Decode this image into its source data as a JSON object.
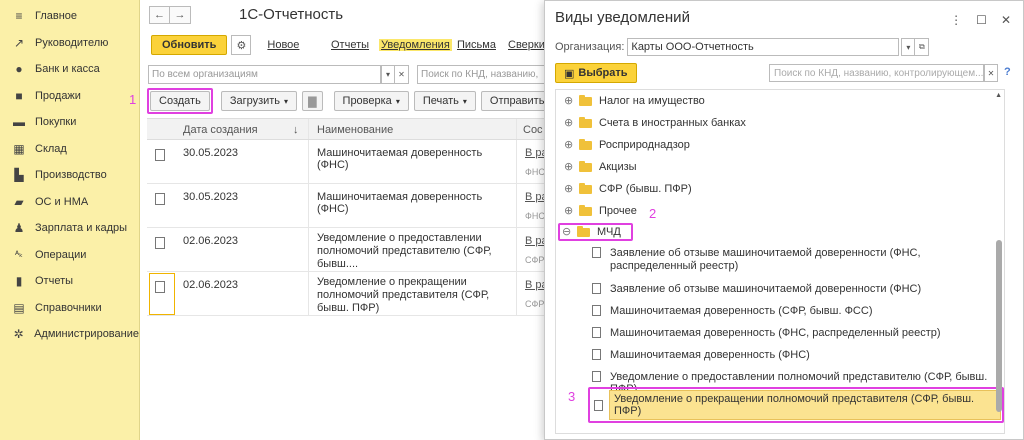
{
  "sidebar": {
    "items": [
      {
        "label": "Главное",
        "icon": "menu-icon",
        "glyph": "≡"
      },
      {
        "label": "Руководителю",
        "icon": "chart-trend-icon",
        "glyph": "↗"
      },
      {
        "label": "Банк и касса",
        "icon": "coins-icon",
        "glyph": "●"
      },
      {
        "label": "Продажи",
        "icon": "bag-icon",
        "glyph": "■"
      },
      {
        "label": "Покупки",
        "icon": "cart-icon",
        "glyph": "▬"
      },
      {
        "label": "Склад",
        "icon": "warehouse-icon",
        "glyph": "▦"
      },
      {
        "label": "Производство",
        "icon": "factory-icon",
        "glyph": "▙"
      },
      {
        "label": "ОС и НМА",
        "icon": "truck-icon",
        "glyph": "▰"
      },
      {
        "label": "Зарплата и кадры",
        "icon": "people-icon",
        "glyph": "♟"
      },
      {
        "label": "Операции",
        "icon": "operations-icon",
        "glyph": "ᴬₖ"
      },
      {
        "label": "Отчеты",
        "icon": "bar-chart-icon",
        "glyph": "▮"
      },
      {
        "label": "Справочники",
        "icon": "book-icon",
        "glyph": "▤"
      },
      {
        "label": "Администрирование",
        "icon": "gear-icon",
        "glyph": "✲"
      }
    ]
  },
  "main": {
    "title": "1С-Отчетность",
    "back": "←",
    "forward": "→",
    "refresh_label": "Обновить",
    "new_label": "Новое",
    "tabs": [
      "Отчеты",
      "Уведомления",
      "Письма",
      "Сверки"
    ],
    "org_placeholder": "По всем организациям",
    "search_placeholder": "Поиск по КНД, названию,",
    "toolbar": {
      "create": "Создать",
      "load": "Загрузить",
      "check": "Проверка",
      "print": "Печать",
      "send": "Отправить"
    },
    "table": {
      "columns": [
        "Дата создания",
        "Наименование",
        "Сос"
      ],
      "rows": [
        {
          "date": "30.05.2023",
          "name": "Машиночитаемая доверенность (ФНС)",
          "status": "В ра",
          "sub": "ФНС"
        },
        {
          "date": "30.05.2023",
          "name": "Машиночитаемая доверенность (ФНС)",
          "status": "В ра",
          "sub": "ФНС"
        },
        {
          "date": "02.06.2023",
          "name": "Уведомление о предоставлении полномочий представителю (СФР, бывш....",
          "status": "В ра",
          "sub": "СФР"
        },
        {
          "date": "02.06.2023",
          "name": "Уведомление о прекращении полномочий представителя (СФР, бывш. ПФР)",
          "status": "В ра",
          "sub": "СФР"
        }
      ]
    }
  },
  "dialog": {
    "title": "Виды уведомлений",
    "org_label": "Организация:",
    "org_value": "Карты ООО-Отчетность",
    "select_label": "Выбрать",
    "search_placeholder": "Поиск по КНД, названию, контролирующем...",
    "folders": [
      "Налог на имущество",
      "Счета в иностранных банках",
      "Росприроднадзор",
      "Акцизы",
      "СФР (бывш. ПФР)",
      "Прочее"
    ],
    "mcd_folder": "МЧД",
    "leaves": [
      "Заявление об отзыве машиночитаемой доверенности (ФНС, распределенный реестр)",
      "Заявление об отзыве машиночитаемой доверенности (ФНС)",
      "Машиночитаемая доверенность (СФР, бывш. ФСС)",
      "Машиночитаемая доверенность (ФНС, распределенный реестр)",
      "Машиночитаемая доверенность (ФНС)",
      "Уведомление о предоставлении полномочий представителю (СФР, бывш. ПФР)",
      "Уведомление о прекращении полномочий представителя (СФР, бывш. ПФР)"
    ]
  },
  "markers": {
    "m1": "1",
    "m2": "2",
    "m3": "3"
  },
  "colors": {
    "sidebar_bg": "#fbf0a8",
    "accent_yellow": "#fbd23a",
    "highlight_magenta": "#e040e0",
    "folder": "#f0c13a"
  }
}
